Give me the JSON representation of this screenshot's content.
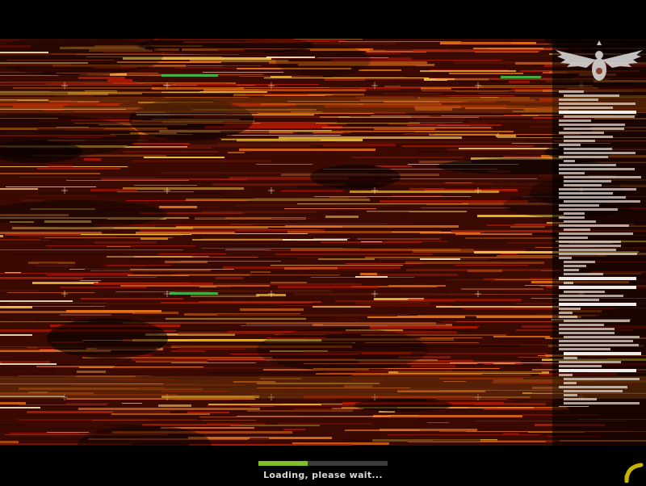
{
  "loading": {
    "text": "Loading, please wait...",
    "progress": 0.38
  },
  "colors": {
    "background": "#000000",
    "fire_dark": "#3a0a02",
    "fire_red": "#b01a05",
    "fire_orange": "#e8731a",
    "fire_yellow": "#f5c542",
    "fire_highlight": "#fff1c9",
    "accent_green": "#3fbf4a",
    "loader_fill": "#7fbf2a",
    "loader_track": "#3b3b3b",
    "loading_text": "#d8d8d8",
    "corner_logo": "#c8b400"
  },
  "icons": {
    "emblem": "winged-bird-emblem-icon",
    "corner_logo": "arc-logo-icon",
    "crosshair_marker": "plus-marker-icon"
  }
}
